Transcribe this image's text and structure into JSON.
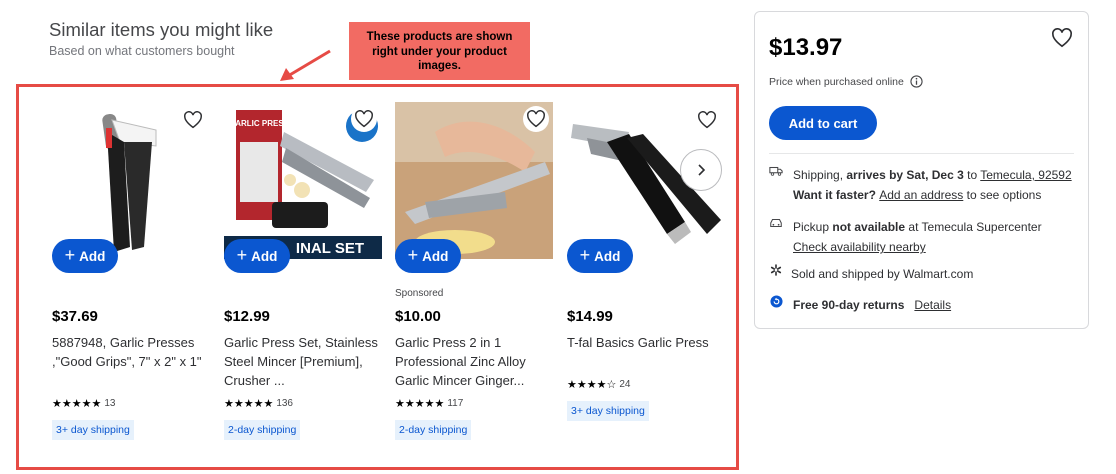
{
  "section": {
    "title": "Similar items you might like",
    "subtitle": "Based on what customers bought"
  },
  "callout": {
    "text": "These products are shown right under your product images."
  },
  "colors": {
    "accent": "#0b57d0",
    "callout_bg": "#f26b63",
    "highlight_border": "#e64b45",
    "shipping_badge_bg": "#e6f1fc"
  },
  "products": [
    {
      "add_label": "Add",
      "sponsored": "",
      "price": "$37.69",
      "title": "5887948, Garlic Presses ,\"Good Grips\", 7\" x 2\" x 1\"",
      "stars": "★★★★★",
      "rating": 4.5,
      "review_count": "13",
      "shipping": "3+ day shipping",
      "image_icon": "garlic-press-black-handles-icon"
    },
    {
      "add_label": "Add",
      "sponsored": "",
      "price": "$12.99",
      "title": "Garlic Press Set, Stainless Steel Mincer [Premium], Crusher ...",
      "stars": "★★★★★",
      "rating": 4.5,
      "review_count": "136",
      "shipping": "2-day shipping",
      "image_banner": "INAL SET",
      "image_box_text": "GARLIC PRESS",
      "image_icon": "garlic-press-set-box-icon"
    },
    {
      "add_label": "Add",
      "sponsored": "Sponsored",
      "price": "$10.00",
      "title": "Garlic Press 2 in 1 Professional Zinc Alloy Garlic Mincer Ginger...",
      "stars": "★★★★★",
      "rating": 4.5,
      "review_count": "117",
      "shipping": "2-day shipping",
      "image_icon": "garlic-press-in-use-photo-icon"
    },
    {
      "add_label": "Add",
      "sponsored": "",
      "price": "$14.99",
      "title": "T-fal Basics Garlic Press",
      "stars": "★★★★☆",
      "rating": 4,
      "review_count": "24",
      "shipping": "3+ day shipping",
      "image_icon": "garlic-press-tfal-icon"
    }
  ],
  "panel": {
    "price": "$13.97",
    "price_note": "Price when purchased online",
    "add_to_cart": "Add to cart",
    "shipping_label": "Shipping, ",
    "shipping_date": "arrives by Sat, Dec 3",
    "shipping_to": " to ",
    "shipping_location": "Temecula, 92592",
    "faster_q": "Want it faster? ",
    "add_address": "Add an address",
    "see_options": " to see options",
    "pickup_label": "Pickup ",
    "pickup_status": "not available",
    "pickup_store": " at Temecula Supercenter",
    "check_availability": "Check availability nearby",
    "sold_by": "Sold and shipped by Walmart.com",
    "returns": "Free 90-day returns",
    "details": "Details"
  }
}
